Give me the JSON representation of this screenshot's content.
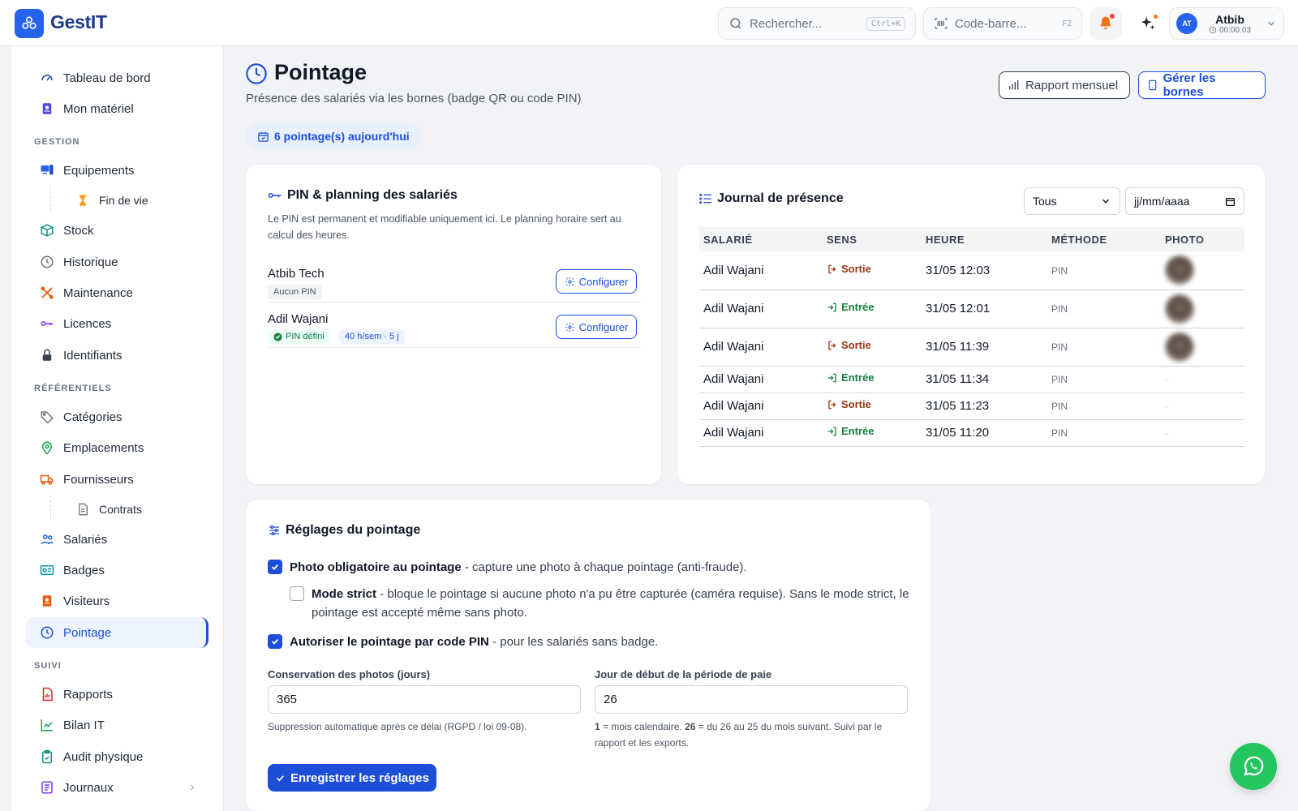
{
  "app": {
    "name": "GestIT"
  },
  "topbar": {
    "search_placeholder": "Rechercher...",
    "search_shortcut": "Ctrl+K",
    "barcode_placeholder": "Code-barre...",
    "barcode_shortcut": "F2",
    "user": {
      "initials": "AT",
      "name": "Atbib",
      "timer": "00:00:03"
    }
  },
  "sidebar": {
    "items": {
      "dashboard": "Tableau de bord",
      "mon_materiel": "Mon matériel",
      "section_gestion": "GESTION",
      "equipements": "Equipements",
      "fin_de_vie": "Fin de vie",
      "stock": "Stock",
      "historique": "Historique",
      "maintenance": "Maintenance",
      "licences": "Licences",
      "identifiants": "Identifiants",
      "section_referentiels": "RÉFÉRENTIELS",
      "categories": "Catégories",
      "emplacements": "Emplacements",
      "fournisseurs": "Fournisseurs",
      "contrats": "Contrats",
      "salaries": "Salariés",
      "badges": "Badges",
      "visiteurs": "Visiteurs",
      "pointage": "Pointage",
      "section_suivi": "SUIVI",
      "rapports": "Rapports",
      "bilan_it": "Bilan IT",
      "audit_physique": "Audit physique",
      "journaux": "Journaux"
    }
  },
  "page": {
    "title": "Pointage",
    "subtitle": "Présence des salariés via les bornes (badge QR ou code PIN)",
    "btn_report": "Rapport mensuel",
    "btn_bornes": "Gérer les bornes",
    "today_count": "6 pointage(s) aujourd'hui"
  },
  "pin_card": {
    "title": "PIN & planning des salariés",
    "description": "Le PIN est permanent et modifiable uniquement ici. Le planning horaire sert au calcul des heures.",
    "configure_label": "Configurer",
    "employees": [
      {
        "name": "Atbib Tech",
        "pin_status": "Aucun PIN"
      },
      {
        "name": "Adil Wajani",
        "pin_status": "PIN défini",
        "planning": "40 h/sem · 5 j"
      }
    ]
  },
  "journal": {
    "title": "Journal de présence",
    "filter_value": "Tous",
    "date_placeholder": "jj/mm/aaaa",
    "columns": [
      "SALARIÉ",
      "SENS",
      "HEURE",
      "MÉTHODE",
      "PHOTO"
    ],
    "rows": [
      {
        "salarie": "Adil Wajani",
        "sens": "Sortie",
        "heure": "31/05 12:03",
        "methode": "PIN",
        "photo": true
      },
      {
        "salarie": "Adil Wajani",
        "sens": "Entrée",
        "heure": "31/05 12:01",
        "methode": "PIN",
        "photo": true
      },
      {
        "salarie": "Adil Wajani",
        "sens": "Sortie",
        "heure": "31/05 11:39",
        "methode": "PIN",
        "photo": true
      },
      {
        "salarie": "Adil Wajani",
        "sens": "Entrée",
        "heure": "31/05 11:34",
        "methode": "PIN",
        "photo": false
      },
      {
        "salarie": "Adil Wajani",
        "sens": "Sortie",
        "heure": "31/05 11:23",
        "methode": "PIN",
        "photo": false
      },
      {
        "salarie": "Adil Wajani",
        "sens": "Entrée",
        "heure": "31/05 11:20",
        "methode": "PIN",
        "photo": false
      }
    ],
    "no_photo": "-"
  },
  "settings": {
    "title": "Réglages du pointage",
    "photo_required": {
      "checked": true,
      "label": "Photo obligatoire au pointage",
      "desc": " - capture une photo à chaque pointage (anti-fraude)."
    },
    "strict_mode": {
      "checked": false,
      "label": "Mode strict",
      "desc": " - bloque le pointage si aucune photo n'a pu être capturée (caméra requise). Sans le mode strict, le pointage est accepté même sans photo."
    },
    "pin_allowed": {
      "checked": true,
      "label": "Autoriser le pointage par code PIN",
      "desc": " - pour les salariés sans badge."
    },
    "retention_label": "Conservation des photos (jours)",
    "retention_value": "365",
    "retention_help": "Suppression automatique après ce délai (RGPD / loi 09-08).",
    "payday_label": "Jour de début de la période de paie",
    "payday_value": "26",
    "payday_help_1": "1",
    "payday_help_2": " = mois calendaire. ",
    "payday_help_3": "26",
    "payday_help_4": " = du 26 au 25 du mois suivant. Suivi par le rapport et les exports.",
    "save_label": "Enregistrer les réglages"
  },
  "colors": {
    "primary": "#1d4ed8",
    "success": "#15803d",
    "danger": "#9a3412",
    "whatsapp": "#22c55e"
  }
}
